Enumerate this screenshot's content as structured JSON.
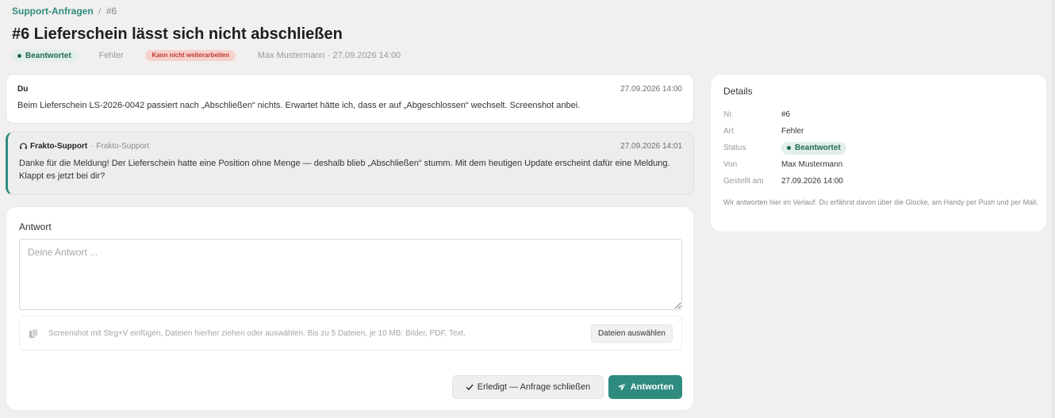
{
  "breadcrumb": {
    "parent": "Support-Anfragen",
    "separator": "/",
    "current": "#6"
  },
  "title": "#6 Lieferschein lässt sich nicht abschließen",
  "meta": {
    "status": "Beantwortet",
    "type": "Fehler",
    "priority": "Kann nicht weiterarbeiten",
    "author_date": "Max Mustermann · 27.09.2026 14:00",
    "separator": "·"
  },
  "messages": [
    {
      "author": "Du",
      "role": "",
      "time": "27.09.2026 14:00",
      "body": "Beim Lieferschein LS-2026-0042 passiert nach „Abschließen“ nichts. Erwartet hätte ich, dass er auf „Abgeschlossen“ wechselt. Screenshot anbei."
    },
    {
      "author": "Frakto-Support",
      "role": "· Frakto-Support",
      "time": "27.09.2026 14:01",
      "body": "Danke für die Meldung! Der Lieferschein hatte eine Position ohne Menge — deshalb blieb „Abschließen“ stumm. Mit dem heutigen Update erscheint dafür eine Meldung. Klappt es jetzt bei dir?",
      "icon": "headset-icon"
    }
  ],
  "reply": {
    "label": "Antwort",
    "placeholder": "Deine Antwort ...",
    "dropzone_hint": "Screenshot mit Strg+V einfügen, Dateien hierher ziehen oder auswählen. Bis zu 5 Dateien, je 10 MB: Bilder, PDF, Text.",
    "files_button": "Dateien auswählen",
    "close_button": "Erledigt — Anfrage schließen",
    "send_button": "Antworten"
  },
  "details": {
    "title": "Details",
    "rows": [
      {
        "label": "Nr.",
        "value": "#6"
      },
      {
        "label": "Art",
        "value": "Fehler"
      },
      {
        "label": "Status",
        "value": "Beantwortet"
      },
      {
        "label": "Von",
        "value": "Max Mustermann"
      },
      {
        "label": "Gestellt am",
        "value": "27.09.2026 14:00"
      }
    ],
    "note": "Wir antworten hier im Verlauf. Du erfährst davon über die Glocke, am Handy per Push und per Mail."
  },
  "colors": {
    "accent": "#2e8b7e",
    "status_bg": "#e3efe9",
    "status_fg": "#1f6b4f",
    "priority_bg": "#f6d2cf",
    "priority_fg": "#c0392b",
    "background": "#f1f0ee"
  }
}
